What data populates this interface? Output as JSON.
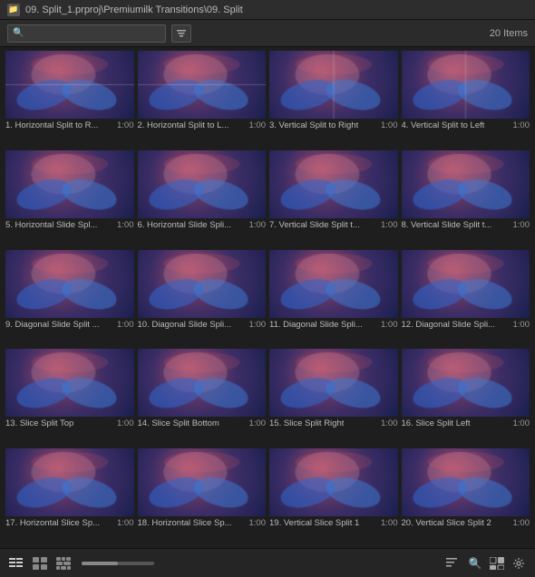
{
  "titleBar": {
    "icon": "📁",
    "text": "09. Split_1.prproj\\Premiumilk Transitions\\09. Split"
  },
  "toolbar": {
    "searchPlaceholder": "",
    "itemsCount": "20 Items"
  },
  "gridItems": [
    {
      "id": 1,
      "name": "1. Horizontal Split to R...",
      "duration": "1:00"
    },
    {
      "id": 2,
      "name": "2. Horizontal Split to L...",
      "duration": "1:00"
    },
    {
      "id": 3,
      "name": "3. Vertical Split to Right",
      "duration": "1:00"
    },
    {
      "id": 4,
      "name": "4. Vertical Split to Left",
      "duration": "1:00"
    },
    {
      "id": 5,
      "name": "5. Horizontal Slide Spl...",
      "duration": "1:00"
    },
    {
      "id": 6,
      "name": "6. Horizontal Slide Spli...",
      "duration": "1:00"
    },
    {
      "id": 7,
      "name": "7. Vertical Slide Split t...",
      "duration": "1:00"
    },
    {
      "id": 8,
      "name": "8. Vertical Slide Split t...",
      "duration": "1:00"
    },
    {
      "id": 9,
      "name": "9. Diagonal Slide Split ...",
      "duration": "1:00"
    },
    {
      "id": 10,
      "name": "10. Diagonal Slide Spli...",
      "duration": "1:00"
    },
    {
      "id": 11,
      "name": "11. Diagonal Slide Spli...",
      "duration": "1:00"
    },
    {
      "id": 12,
      "name": "12. Diagonal Slide Spli...",
      "duration": "1:00"
    },
    {
      "id": 13,
      "name": "13. Slice Split Top",
      "duration": "1:00"
    },
    {
      "id": 14,
      "name": "14. Slice Split Bottom",
      "duration": "1:00"
    },
    {
      "id": 15,
      "name": "15. Slice Split Right",
      "duration": "1:00"
    },
    {
      "id": 16,
      "name": "16. Slice Split Left",
      "duration": "1:00"
    },
    {
      "id": 17,
      "name": "17. Horizontal Slice Sp...",
      "duration": "1:00"
    },
    {
      "id": 18,
      "name": "18. Horizontal Slice Sp...",
      "duration": "1:00"
    },
    {
      "id": 19,
      "name": "19. Vertical Slice Split 1",
      "duration": "1:00"
    },
    {
      "id": 20,
      "name": "20. Vertical Slice Split 2",
      "duration": "1:00"
    }
  ],
  "bottomBar": {
    "sliderValue": 50,
    "icons": {
      "list": "☰",
      "grid": "⊞",
      "freeform": "⣿",
      "search": "🔍",
      "sort": "⇅"
    }
  }
}
